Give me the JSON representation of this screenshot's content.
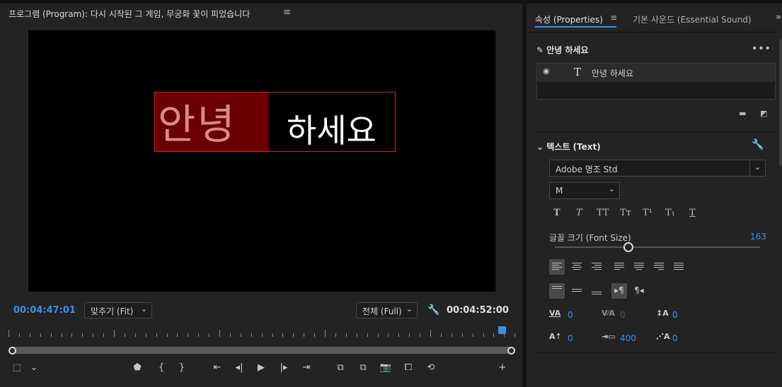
{
  "program": {
    "title": "프로그램 (Program): 다시 시작된 그 게임, 무궁화 꽃이 피었습니다",
    "menu_icon": "≡",
    "title_text_selected": "안녕",
    "title_text_rest": "하세요",
    "timecode_current": "00:04:47:01",
    "zoom_label": "맞추기 (Fit)",
    "resolution_label": "전체 (Full)",
    "timecode_duration": "00:04:52:00"
  },
  "properties": {
    "tab_active": "속성 (Properties)",
    "tab_menu": "≡",
    "tab_2": "기본 사운드 (Essential Sound)",
    "more": "»",
    "layer_header": "안녕 하세요",
    "layer_row_name": "안녕 하세요",
    "text_section": "텍스트 (Text)",
    "font_family": "Adobe 명조 Std",
    "font_style": "M",
    "font_size_label": "글꼴 크기 (Font Size)",
    "font_size_value": "163",
    "font_size_fraction": 0.36,
    "format_buttons": [
      "T",
      "T",
      "TT",
      "Tт",
      "T¹",
      "T₁",
      "T"
    ],
    "kerning": "0",
    "tracking_disabled": "0",
    "leading": "0",
    "baseline_shift": "0",
    "tab_width": "400",
    "tsume": "0"
  },
  "colors": {
    "accent": "#3d8ee6",
    "selection_box": "#d2232a",
    "selection_fill": "#6b0000"
  }
}
